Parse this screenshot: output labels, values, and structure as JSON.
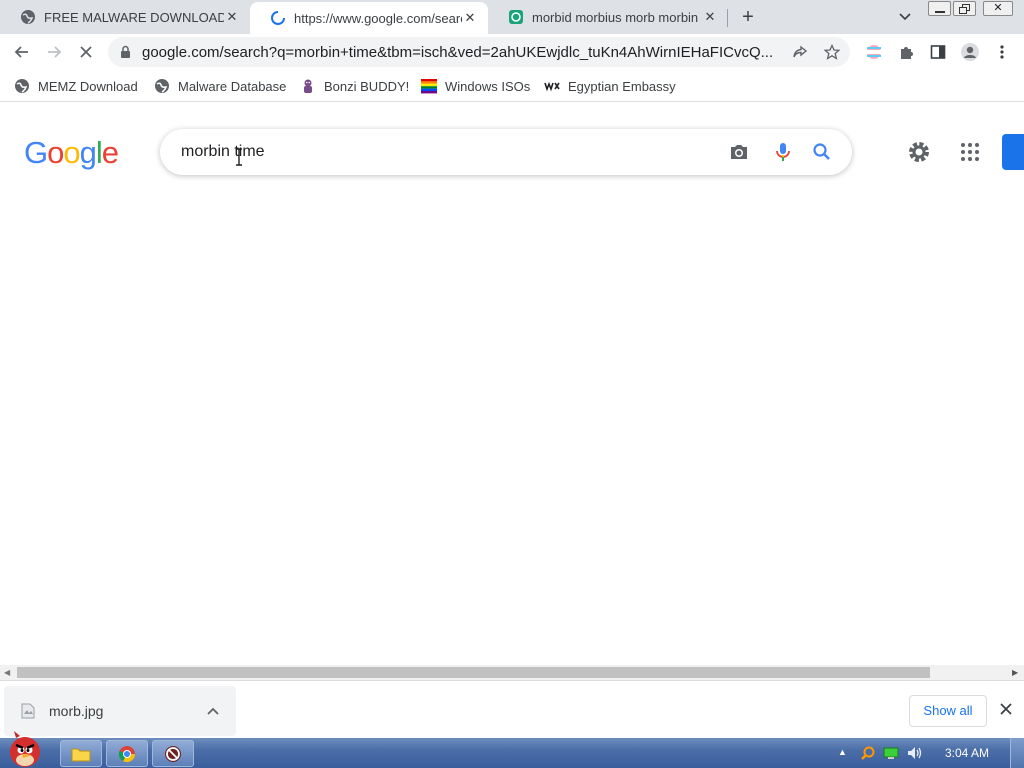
{
  "tabs": [
    {
      "title": "FREE MALWARE DOWNLOAD",
      "icon": "globe-icon",
      "active": false
    },
    {
      "title": "https://www.google.com/search?q=morbin",
      "icon": "loading-spinner-icon",
      "active": true
    },
    {
      "title": "morbid morbius morb morbin",
      "icon": "site-favicon-icon",
      "active": false
    }
  ],
  "toolbar": {
    "url": "google.com/search?q=morbin+time&tbm=isch&ved=2ahUKEwjdlc_tuKn4AhWirnIEHaFICvcQ..."
  },
  "bookmarks": [
    {
      "label": "MEMZ Download",
      "icon": "globe-icon"
    },
    {
      "label": "Malware Database",
      "icon": "globe-icon"
    },
    {
      "label": "Bonzi BUDDY!",
      "icon": "bonzi-icon"
    },
    {
      "label": "Windows ISOs",
      "icon": "rainbow-flag-icon"
    },
    {
      "label": "Egyptian Embassy",
      "icon": "wix-icon"
    }
  ],
  "search": {
    "query": "morbin time"
  },
  "download": {
    "filename": "morb.jpg",
    "show_all": "Show all"
  },
  "taskbar": {
    "time": "3:04 AM"
  },
  "colors": {
    "accent": "#1a73e8",
    "tabstrip": "#dee1e6",
    "taskbar": "#4b6ea8"
  }
}
